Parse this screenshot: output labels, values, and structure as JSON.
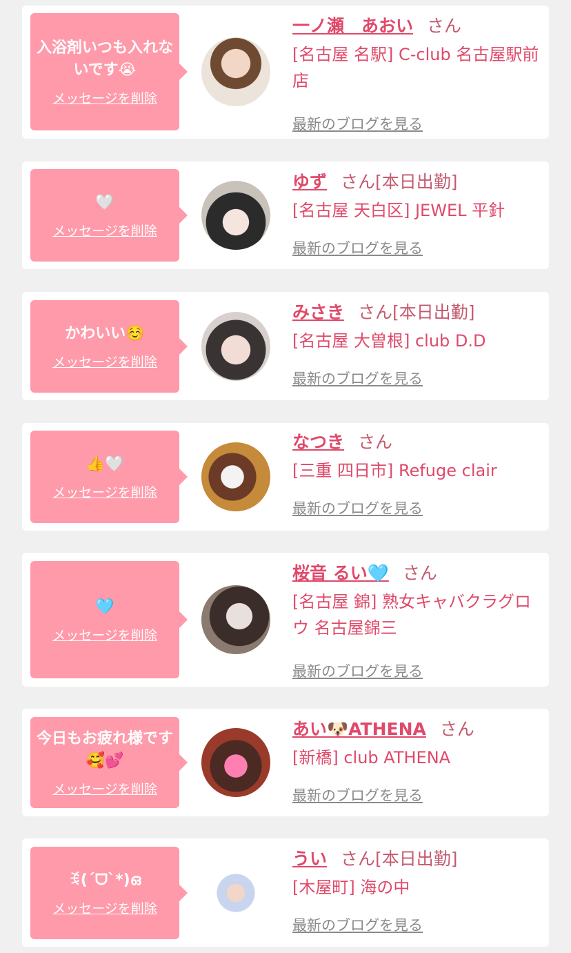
{
  "delete_label": "メッセージを削除",
  "blog_label": "最新のブログを見る",
  "items": [
    {
      "message": "入浴剤いつも入れないです😭",
      "name": "一ノ瀬　あおい",
      "san": "さん",
      "shop": "[名古屋 名駅] C-club 名古屋駅前店"
    },
    {
      "message": "🤍",
      "name": "ゆず",
      "san": "さん[本日出勤]",
      "shop": "[名古屋 天白区] JEWEL 平針"
    },
    {
      "message": "かわいい☺️",
      "name": "みさき",
      "san": "さん[本日出勤]",
      "shop": "[名古屋 大曽根] club D.D"
    },
    {
      "message": "👍🤍",
      "name": "なつき",
      "san": "さん",
      "shop": "[三重 四日市] Refuge clair"
    },
    {
      "message": "🩵",
      "name": "桜音 るい🩵",
      "san": "さん",
      "shop": "[名古屋 錦] 熟女キャバクラグロウ 名古屋錦三"
    },
    {
      "message": "今日もお疲れ様です🥰💕",
      "name": "あい🐶ATHENA",
      "san": "さん",
      "shop": "[新橋] club ATHENA"
    },
    {
      "message": "ꉂ(ˊᗜˋ*)ഒ",
      "name": "うい",
      "san": "さん[本日出勤]",
      "shop": "[木屋町] 海の中"
    }
  ],
  "colors": {
    "bubble": "#ff9aaa",
    "name": "#e0496a",
    "shop": "#e0496a",
    "san": "#c45a6e",
    "blog": "#8a8a8a",
    "page_bg": "#f0f0f0"
  }
}
